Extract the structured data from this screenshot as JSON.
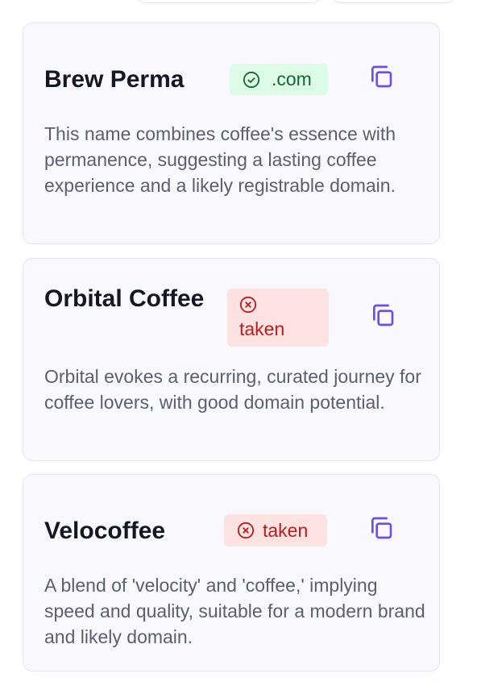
{
  "colors": {
    "card_background": "#f8f8fd",
    "card_border": "#e4e2f7",
    "accent_icon": "#6d4ee0",
    "available_bg": "#dcfce7",
    "available_text": "#166534",
    "taken_bg": "#fde2e2",
    "taken_text": "#b91c1c"
  },
  "cards": [
    {
      "name": "Brew Perma",
      "status": "available",
      "badge_label": ".com",
      "badge_icon": "check-circle-icon",
      "copy_icon": "copy-icon",
      "description": "This name combines coffee's essence with permanence, suggesting a lasting coffee experience and a likely registrable domain."
    },
    {
      "name": "Orbital Coffee",
      "status": "taken",
      "badge_label": "taken",
      "badge_icon": "x-circle-icon",
      "copy_icon": "copy-icon",
      "description": "Orbital evokes a recurring, curated journey for coffee lovers, with good domain potential."
    },
    {
      "name": "Velocoffee",
      "status": "taken",
      "badge_label": "taken",
      "badge_icon": "x-circle-icon",
      "copy_icon": "copy-icon",
      "description": "A blend of 'velocity' and 'coffee,' implying speed and quality, suitable for a modern brand and likely domain."
    }
  ]
}
